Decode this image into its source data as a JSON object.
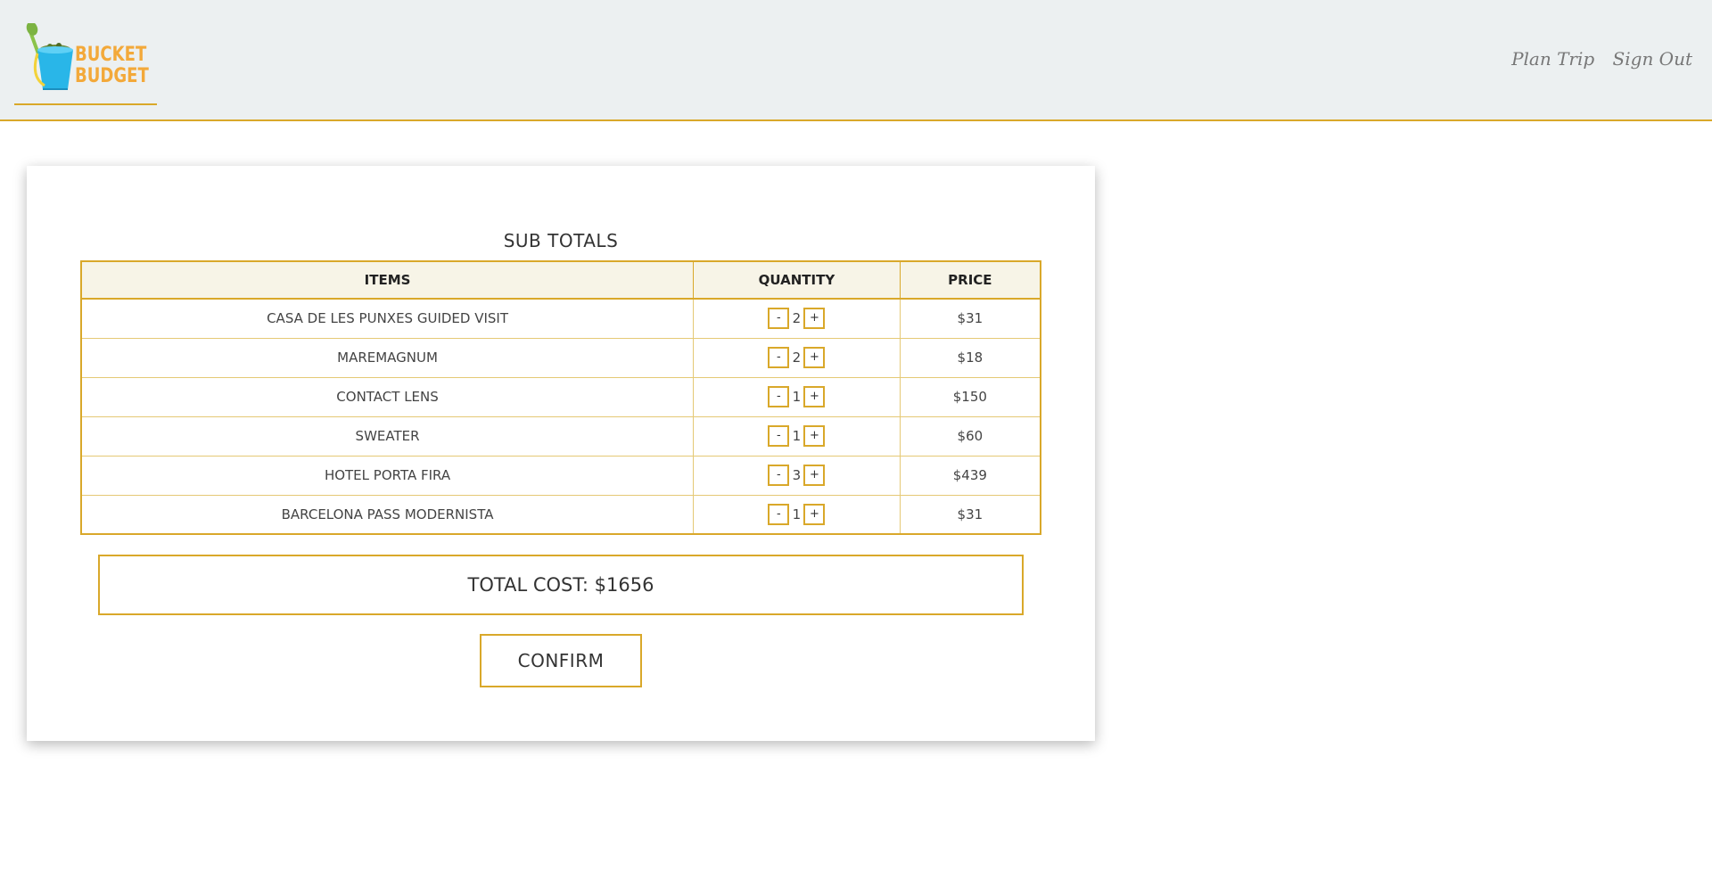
{
  "header": {
    "logo_line1": "BUCKET",
    "logo_line2": "BUDGET",
    "nav": [
      {
        "label": "Plan Trip"
      },
      {
        "label": "Sign Out"
      }
    ]
  },
  "card": {
    "title": "SUB TOTALS",
    "columns": [
      "ITEMS",
      "QUANTITY",
      "PRICE"
    ],
    "rows": [
      {
        "item": "CASA DE LES PUNXES GUIDED VISIT",
        "qty": "2",
        "price": "$31"
      },
      {
        "item": "MAREMAGNUM",
        "qty": "2",
        "price": "$18"
      },
      {
        "item": "CONTACT LENS",
        "qty": "1",
        "price": "$150"
      },
      {
        "item": "SWEATER",
        "qty": "1",
        "price": "$60"
      },
      {
        "item": "HOTEL PORTA FIRA",
        "qty": "3",
        "price": "$439"
      },
      {
        "item": "BARCELONA PASS MODERNISTA",
        "qty": "1",
        "price": "$31"
      }
    ],
    "minus_label": "-",
    "plus_label": "+",
    "total_label": "TOTAL COST: $1656",
    "confirm_label": "CONFIRM"
  },
  "colors": {
    "accent": "#d9a82a",
    "header_bg": "#ecf0f1",
    "logo_text": "#f3a93a",
    "bucket": "#29b6e8",
    "shovel": "#8bc34a"
  }
}
